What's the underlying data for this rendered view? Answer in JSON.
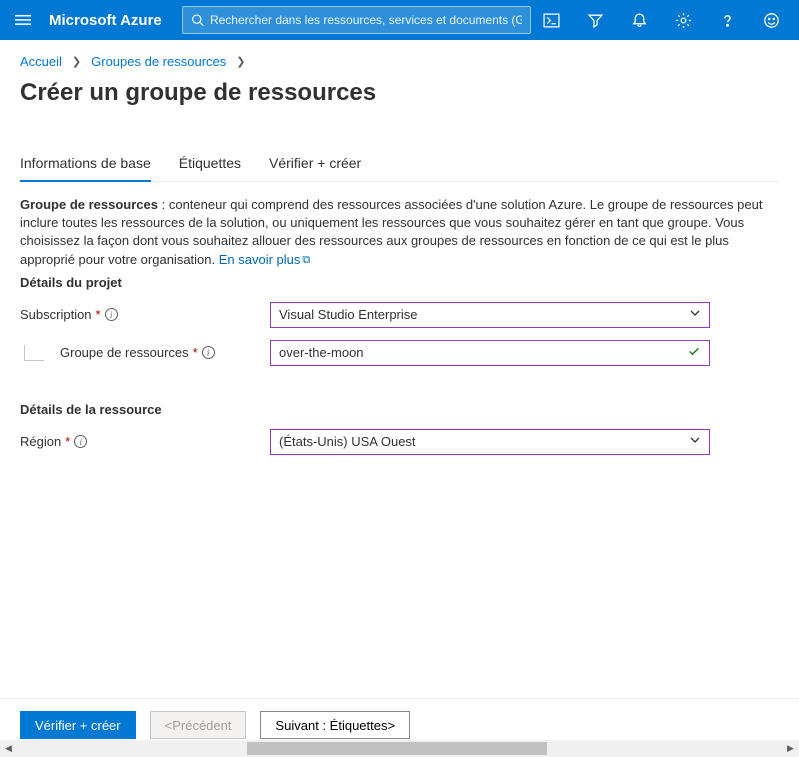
{
  "header": {
    "brand": "Microsoft Azure",
    "search_placeholder": "Rechercher dans les ressources, services et documents (G+/)"
  },
  "breadcrumb": {
    "home": "Accueil",
    "resource_groups": "Groupes de ressources"
  },
  "page": {
    "title": "Créer un groupe de ressources"
  },
  "tabs": {
    "basics": "Informations de base",
    "tags": "Étiquettes",
    "review": "Vérifier + créer"
  },
  "desc": {
    "bold": "Groupe de ressources",
    "text": " : conteneur qui comprend des ressources associées d'une solution Azure. Le groupe de ressources peut inclure toutes les ressources de la solution, ou uniquement les ressources que vous souhaitez gérer en tant que groupe. Vous choisissez la façon dont vous souhaitez allouer des ressources aux groupes de ressources en fonction de ce qui est le plus approprié pour votre organisation. ",
    "learn_more": "En savoir plus"
  },
  "sections": {
    "project": "Détails du projet",
    "resource": "Détails de la ressource"
  },
  "fields": {
    "subscription_label": "Subscription",
    "subscription_value": "Visual Studio Enterprise",
    "rg_label": "Groupe de ressources",
    "rg_value": "over-the-moon",
    "region_label": "Région",
    "region_value": "(États-Unis) USA Ouest"
  },
  "footer": {
    "review": "Vérifier + créer",
    "previous_prefix": "< ",
    "previous_label": "Précédent",
    "next_label": "Suivant : Étiquettes",
    "next_suffix": " >"
  }
}
